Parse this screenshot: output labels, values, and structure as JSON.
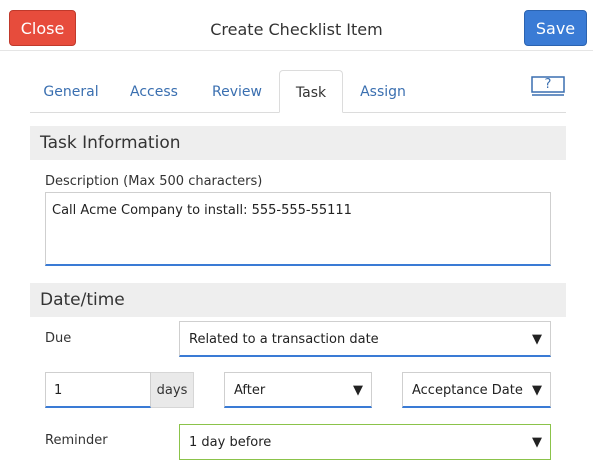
{
  "header": {
    "close_label": "Close",
    "title": "Create Checklist Item",
    "save_label": "Save"
  },
  "tabs": [
    {
      "label": "General"
    },
    {
      "label": "Access"
    },
    {
      "label": "Review"
    },
    {
      "label": "Task",
      "active": true
    },
    {
      "label": "Assign"
    }
  ],
  "help": {
    "label": "?"
  },
  "task_info": {
    "heading": "Task Information",
    "description_label": "Description (Max 500 characters)",
    "description_value": "Call Acme Company to install: 555-555-55111"
  },
  "datetime": {
    "heading": "Date/time",
    "due_label": "Due",
    "due_value": "Related to a transaction date",
    "offset_value": "1",
    "offset_unit": "days",
    "relation_value": "After",
    "date_ref_value": "Acceptance Date",
    "reminder_label": "Reminder",
    "reminder_value": "1 day before"
  },
  "icons": {
    "caret": "▼"
  },
  "colors": {
    "close": "#e74c3c",
    "save": "#3a7bd5",
    "focus": "#3a7bd5",
    "reminder_border": "#8bc34a"
  }
}
